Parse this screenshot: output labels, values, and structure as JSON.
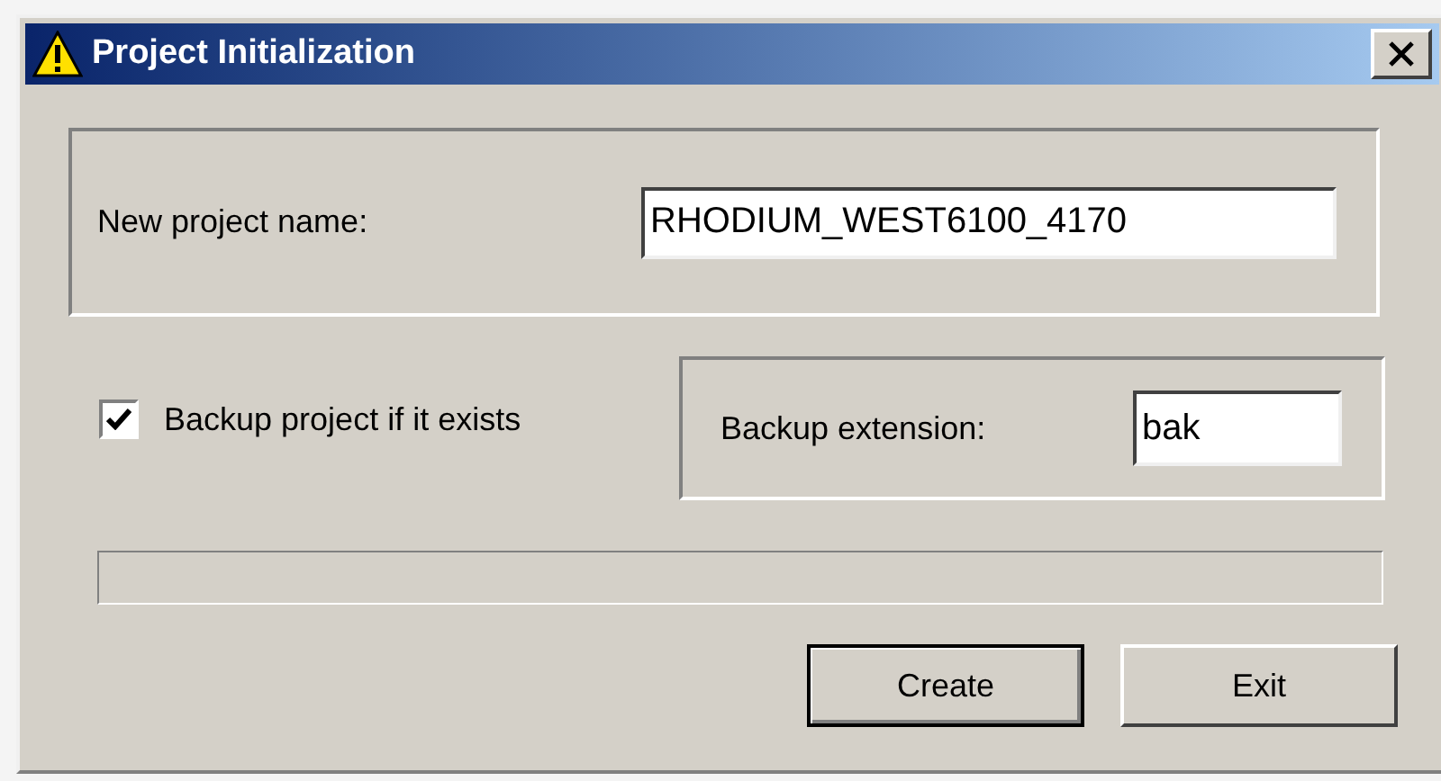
{
  "window": {
    "title": "Project Initialization"
  },
  "project_name": {
    "label": "New project name:",
    "value": "RHODIUM_WEST6100_4170"
  },
  "backup_checkbox": {
    "label": "Backup project if it exists",
    "checked": true
  },
  "backup_extension": {
    "label": "Backup extension:",
    "value": "bak"
  },
  "buttons": [
    {
      "label": "Create",
      "default": true
    },
    {
      "label": "Exit",
      "default": false
    }
  ]
}
